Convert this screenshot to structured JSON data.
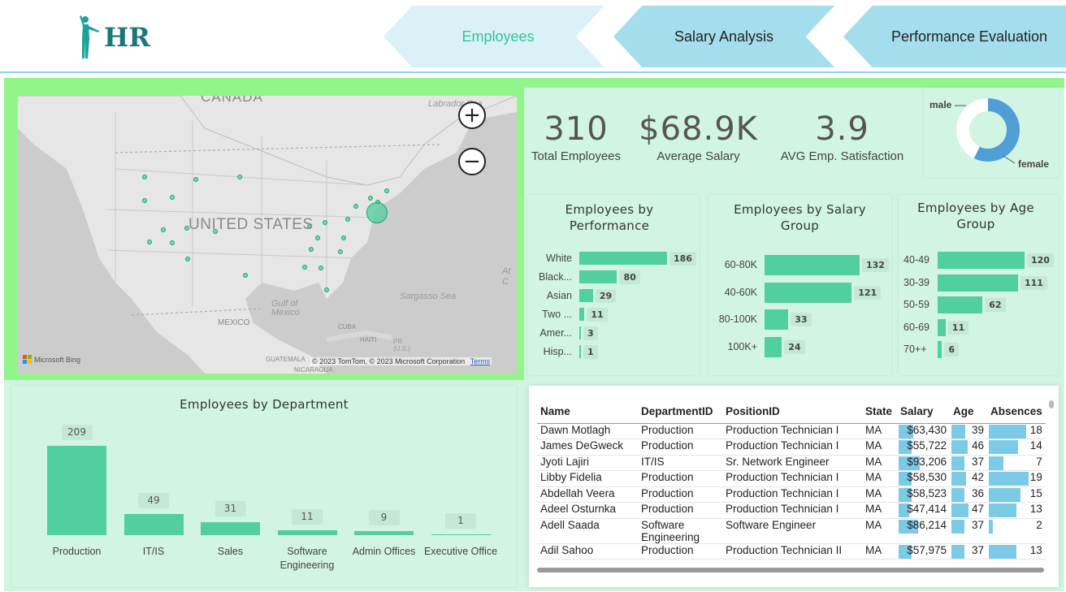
{
  "header": {
    "logo_text": "HR",
    "tabs": [
      "Employees",
      "Salary Analysis",
      "Performance Evaluation"
    ]
  },
  "map": {
    "labels": {
      "country_us": "UNITED STATES",
      "canada": "CANADA",
      "labrador": "Labrador Sea",
      "mexico": "MEXICO",
      "gulf": "Gulf of Mexico",
      "sargasso": "Sargasso Sea",
      "cuba": "CUBA",
      "haiti": "HAITI",
      "pr": "PR (U.S.)",
      "guatemala": "GUATEMALA",
      "nicaragua": "NICARAGUA",
      "atlantic": "At C"
    },
    "attribution": "© 2023 TomTom, © 2023 Microsoft Corporation",
    "terms": "Terms",
    "bing": "Microsoft Bing",
    "zoom_in": "+",
    "zoom_out": "−"
  },
  "kpis": [
    {
      "value": "310",
      "label": "Total Employees"
    },
    {
      "value": "$68.9K",
      "label": "Average Salary"
    },
    {
      "value": "3.9",
      "label": "AVG Emp. Satisfaction"
    }
  ],
  "gender": {
    "male_label": "male",
    "female_label": "female",
    "colors": {
      "male": "#ffffff",
      "female": "#4f9fd6"
    }
  },
  "charts": {
    "performance": {
      "title": "Employees by Performance",
      "categories": [
        "White",
        "Black...",
        "Asian",
        "Two ...",
        "Amer...",
        "Hisp..."
      ],
      "values": [
        186,
        80,
        29,
        11,
        3,
        1
      ]
    },
    "salary_group": {
      "title": "Employees by Salary Group",
      "categories": [
        "60-80K",
        "40-60K",
        "80-100K",
        "100K+"
      ],
      "values": [
        132,
        121,
        33,
        24
      ]
    },
    "age_group": {
      "title": "Employees by Age Group",
      "categories": [
        "40-49",
        "30-39",
        "50-59",
        "60-69",
        "70++"
      ],
      "values": [
        120,
        111,
        62,
        11,
        6
      ]
    },
    "department": {
      "title": "Employees by Department",
      "categories": [
        "Production",
        "IT/IS",
        "Sales",
        "Software Engineering",
        "Admin Offices",
        "Executive Office"
      ],
      "values": [
        209,
        49,
        31,
        11,
        9,
        1
      ]
    }
  },
  "chart_data": [
    {
      "type": "bar",
      "title": "Employees by Performance",
      "categories": [
        "White",
        "Black...",
        "Asian",
        "Two ...",
        "Amer...",
        "Hisp..."
      ],
      "values": [
        186,
        80,
        29,
        11,
        3,
        1
      ]
    },
    {
      "type": "bar",
      "title": "Employees by Salary Group",
      "categories": [
        "60-80K",
        "40-60K",
        "80-100K",
        "100K+"
      ],
      "values": [
        132,
        121,
        33,
        24
      ]
    },
    {
      "type": "bar",
      "title": "Employees by Age Group",
      "categories": [
        "40-49",
        "30-39",
        "50-59",
        "60-69",
        "70++"
      ],
      "values": [
        120,
        111,
        62,
        11,
        6
      ]
    },
    {
      "type": "bar",
      "title": "Employees by Department",
      "categories": [
        "Production",
        "IT/IS",
        "Sales",
        "Software Engineering",
        "Admin Offices",
        "Executive Office"
      ],
      "values": [
        209,
        49,
        31,
        11,
        9,
        1
      ]
    }
  ],
  "table": {
    "columns": [
      "Name",
      "DepartmentID",
      "PositionID",
      "State",
      "Salary",
      "Age",
      "Absences"
    ],
    "rows": [
      [
        "Dawn Motlagh",
        "Production",
        "Production Technician I",
        "MA",
        "$63,430",
        "39",
        "18"
      ],
      [
        "James DeGweck",
        "Production",
        "Production Technician I",
        "MA",
        "$55,722",
        "46",
        "14"
      ],
      [
        "Jyoti Lajiri",
        "IT/IS",
        "Sr. Network Engineer",
        "MA",
        "$93,206",
        "37",
        "7"
      ],
      [
        "Libby Fidelia",
        "Production",
        "Production Technician I",
        "MA",
        "$58,530",
        "42",
        "19"
      ],
      [
        "Abdellah Veera",
        "Production",
        "Production Technician I",
        "MA",
        "$58,523",
        "36",
        "15"
      ],
      [
        "Adeel Osturnka",
        "Production",
        "Production Technician I",
        "MA",
        "$47,414",
        "47",
        "13"
      ],
      [
        "Adell Saada",
        "Software Engineering",
        "Software Engineer",
        "MA",
        "$86,214",
        "37",
        "2"
      ],
      [
        "Adil Sahoo",
        "Production",
        "Production Technician II",
        "MA",
        "$57,975",
        "37",
        "13"
      ]
    ]
  },
  "colors": {
    "bar": "#52cfa0",
    "accent": "#35c493",
    "teal": "#19777a",
    "tab_active": "#d9f1f7",
    "tab": "#a4ddeb"
  }
}
